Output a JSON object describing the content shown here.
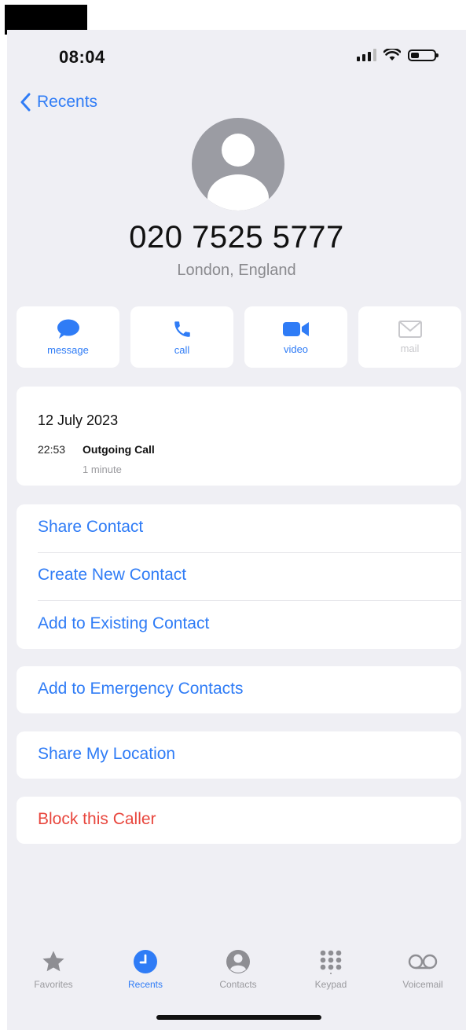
{
  "status_bar": {
    "time": "08:04"
  },
  "nav": {
    "back_label": "Recents"
  },
  "contact": {
    "number": "020 7525 5777",
    "location": "London, England"
  },
  "actions": [
    {
      "label": "message",
      "icon": "message-bubble-icon",
      "enabled": true
    },
    {
      "label": "call",
      "icon": "phone-icon",
      "enabled": true
    },
    {
      "label": "video",
      "icon": "video-camera-icon",
      "enabled": true
    },
    {
      "label": "mail",
      "icon": "envelope-icon",
      "enabled": false
    }
  ],
  "call_history": {
    "date": "12 July 2023",
    "time": "22:53",
    "type": "Outgoing Call",
    "duration": "1 minute"
  },
  "options": {
    "share_contact": "Share Contact",
    "create_new_contact": "Create New Contact",
    "add_to_existing": "Add to Existing Contact",
    "add_to_emergency": "Add to Emergency Contacts",
    "share_location": "Share My Location",
    "block_caller": "Block this Caller"
  },
  "tab_bar": {
    "favorites": "Favorites",
    "recents": "Recents",
    "contacts": "Contacts",
    "keypad": "Keypad",
    "voicemail": "Voicemail",
    "active": "Recents"
  },
  "colors": {
    "accent": "#2f7cf6",
    "danger": "#e8463d",
    "background": "#efeff4",
    "battery_level": 0.35
  }
}
